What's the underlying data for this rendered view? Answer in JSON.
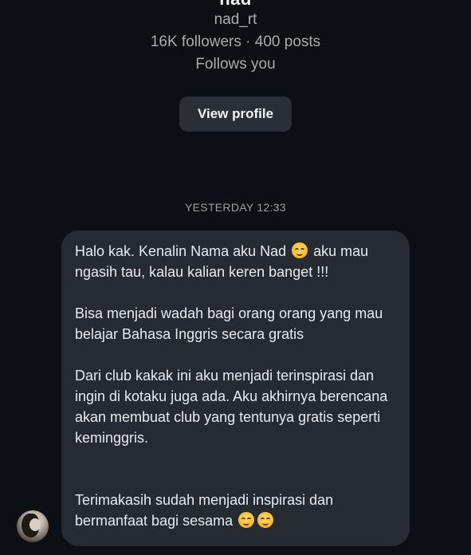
{
  "profile": {
    "name": "nad",
    "handle": "nad_rt",
    "stats": "16K followers · 400 posts",
    "follows_status": "Follows you",
    "view_profile_label": "View profile"
  },
  "conversation": {
    "timestamp": "YESTERDAY 12:33",
    "message": {
      "p1_a": "Halo kak. Kenalin Nama aku Nad",
      "p1_b": " aku mau ngasih tau, kalau kalian keren banget !!!",
      "p2": "Bisa menjadi wadah bagi orang orang yang mau belajar Bahasa Inggris secara gratis",
      "p3": "Dari club kakak ini aku menjadi terinspirasi dan ingin di kotaku juga ada.  Aku akhirnya berencana akan membuat club yang tentunya gratis seperti keminggris.",
      "p4": "Terimakasih sudah menjadi inspirasi dan bermanfaat bagi sesama "
    },
    "emoji_name": "smiling-face-with-smiling-eyes"
  },
  "colors": {
    "background": "#0c0f14",
    "bubble": "#262a31",
    "button": "#2a2e35",
    "secondary_text": "#a8abb0",
    "primary_text": "#e9eaec"
  }
}
